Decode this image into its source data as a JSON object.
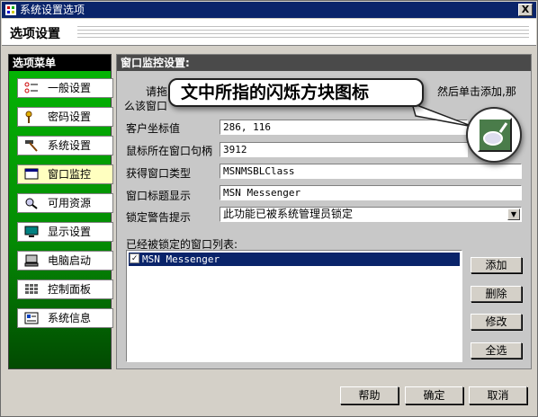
{
  "window": {
    "title": "系统设置选项",
    "close_glyph": "X"
  },
  "header": {
    "title": "选项设置"
  },
  "menu": {
    "title": "选项菜单",
    "items": [
      {
        "label": "一般设置",
        "icon": "list-icon"
      },
      {
        "label": "密码设置",
        "icon": "key-icon"
      },
      {
        "label": "系统设置",
        "icon": "hammer-icon"
      },
      {
        "label": "窗口监控",
        "icon": "monitor-window-icon",
        "active": true
      },
      {
        "label": "可用资源",
        "icon": "magnifier-icon"
      },
      {
        "label": "显示设置",
        "icon": "display-icon"
      },
      {
        "label": "电脑启动",
        "icon": "computer-icon"
      },
      {
        "label": "控制面板",
        "icon": "grid-icon"
      },
      {
        "label": "系统信息",
        "icon": "info-icon"
      }
    ]
  },
  "panel": {
    "title": "窗口监控设置:",
    "hint_start": "请拖",
    "hint_end": "然后单击添加,那",
    "hint_line2": "么该窗口",
    "fields": [
      {
        "label": "客户坐标值",
        "value": "286, 116"
      },
      {
        "label": "鼠标所在窗口句柄",
        "value": "3912"
      },
      {
        "label": "获得窗口类型",
        "value": "MSNMSBLClass"
      },
      {
        "label": "窗口标题显示",
        "value": "MSN Messenger"
      },
      {
        "label": "锁定警告提示",
        "value": "此功能已被系统管理员锁定"
      }
    ],
    "list_label": "已经被锁定的窗口列表:",
    "list_items": [
      {
        "text": "MSN Messenger",
        "checked": "✓"
      }
    ],
    "side_buttons": {
      "add": "添加",
      "delete": "删除",
      "modify": "修改",
      "select_all": "全选"
    }
  },
  "footer": {
    "help": "帮助",
    "ok": "确定",
    "cancel": "取消"
  },
  "callout": {
    "text": "文中所指的闪烁方块图标"
  },
  "colors": {
    "titlebar": "#0a246a",
    "menu_green": "#04b804",
    "selection": "#0a246a"
  }
}
